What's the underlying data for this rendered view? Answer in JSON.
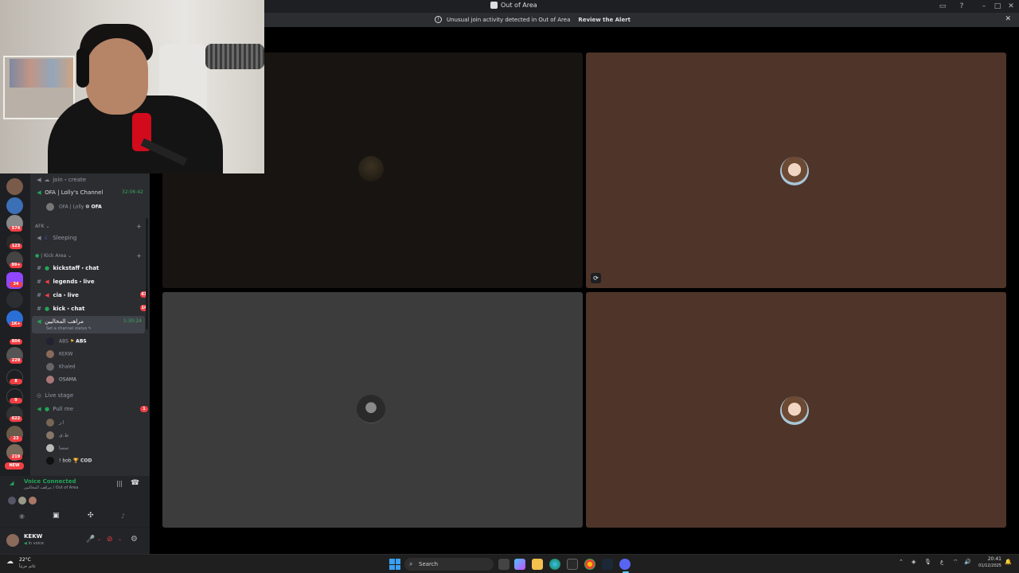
{
  "window": {
    "title": "Out of Area"
  },
  "alert": {
    "message": "Unusual join activity detected in Out of Area",
    "action": "Review the Alert"
  },
  "server_badges": [
    "574",
    "123",
    "99+",
    "34",
    "1K+",
    "804",
    "229",
    "8",
    "9",
    "622",
    "23",
    "219",
    "NEW"
  ],
  "channels": {
    "top_row": "join・create",
    "ofa_channel": {
      "name": "OFA | Lolly's Channel",
      "time": "32:06:42",
      "member": "OFA | Lolly",
      "member_tag": "OFA"
    },
    "afk_category": "AFK",
    "sleeping": "Sleeping",
    "kick_category": "| Kick Area",
    "text_channels": [
      {
        "name": "kickstaff・chat",
        "badge": ""
      },
      {
        "name": "legends・live",
        "badge": ""
      },
      {
        "name": "cia・live",
        "badge": "61"
      },
      {
        "name": "kick・chat",
        "badge": "14"
      }
    ],
    "active_voice": {
      "name": "مراهب المخالبين",
      "time": "1:30:24",
      "status": "Set a channel status"
    },
    "voice_members": [
      {
        "name": "ABS",
        "tag": "ABS"
      },
      {
        "name": "KEKW",
        "tag": ""
      },
      {
        "name": "Khaled",
        "tag": ""
      },
      {
        "name": "OSAMA",
        "tag": ""
      }
    ],
    "live_stage": "Live stage",
    "pull_me": {
      "name": "Pull me",
      "badge": "1"
    },
    "pull_members": [
      "ا.ز",
      "ط.ي",
      "سسا",
      "! bob"
    ],
    "pull_member_tag": "COD"
  },
  "voice": {
    "status": "Voice Connected",
    "location": "مراهب المخالبين / Out of Area"
  },
  "user": {
    "name": "KEKW",
    "status": "In voice"
  },
  "taskbar": {
    "search_placeholder": "Search",
    "weather_temp": "22°C",
    "weather_desc": "غائم جزئياً",
    "time": "20:41",
    "date": "01/12/2025",
    "lang": "ع"
  },
  "colors": {
    "accent": "#5865f2",
    "green": "#23a559",
    "red": "#f23f43",
    "tile_brown": "#4f342a",
    "tile_gray": "#3c3c3c",
    "tile_dark": "#171411"
  }
}
